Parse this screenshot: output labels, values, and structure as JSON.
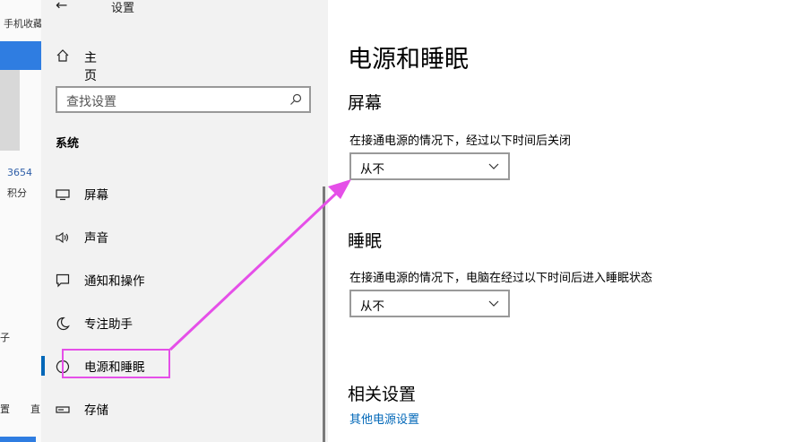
{
  "background_app": {
    "text_top": "手机收藏",
    "score_value": "3654",
    "score_label": "积分",
    "fragment_1": "子",
    "fragment_2": "置",
    "fragment_3": "直"
  },
  "nav": {
    "title": "设置",
    "home_label": "主页",
    "search_placeholder": "查找设置",
    "group_label": "系统",
    "items": [
      {
        "label": "屏幕",
        "icon": "monitor-icon"
      },
      {
        "label": "声音",
        "icon": "speaker-icon"
      },
      {
        "label": "通知和操作",
        "icon": "notification-icon"
      },
      {
        "label": "专注助手",
        "icon": "moon-icon"
      },
      {
        "label": "电源和睡眠",
        "icon": "power-icon",
        "selected": true
      },
      {
        "label": "存储",
        "icon": "storage-icon"
      }
    ]
  },
  "main": {
    "page_title": "电源和睡眠",
    "screen": {
      "heading": "屏幕",
      "description": "在接通电源的情况下，经过以下时间后关闭",
      "value": "从不"
    },
    "sleep": {
      "heading": "睡眠",
      "description": "在接通电源的情况下，电脑在经过以下时间后进入睡眠状态",
      "value": "从不"
    },
    "related": {
      "heading": "相关设置",
      "link": "其他电源设置"
    }
  },
  "colors": {
    "accent": "#0067b8",
    "annotation": "#e54fe8",
    "nav_background": "#f2f2f2"
  }
}
